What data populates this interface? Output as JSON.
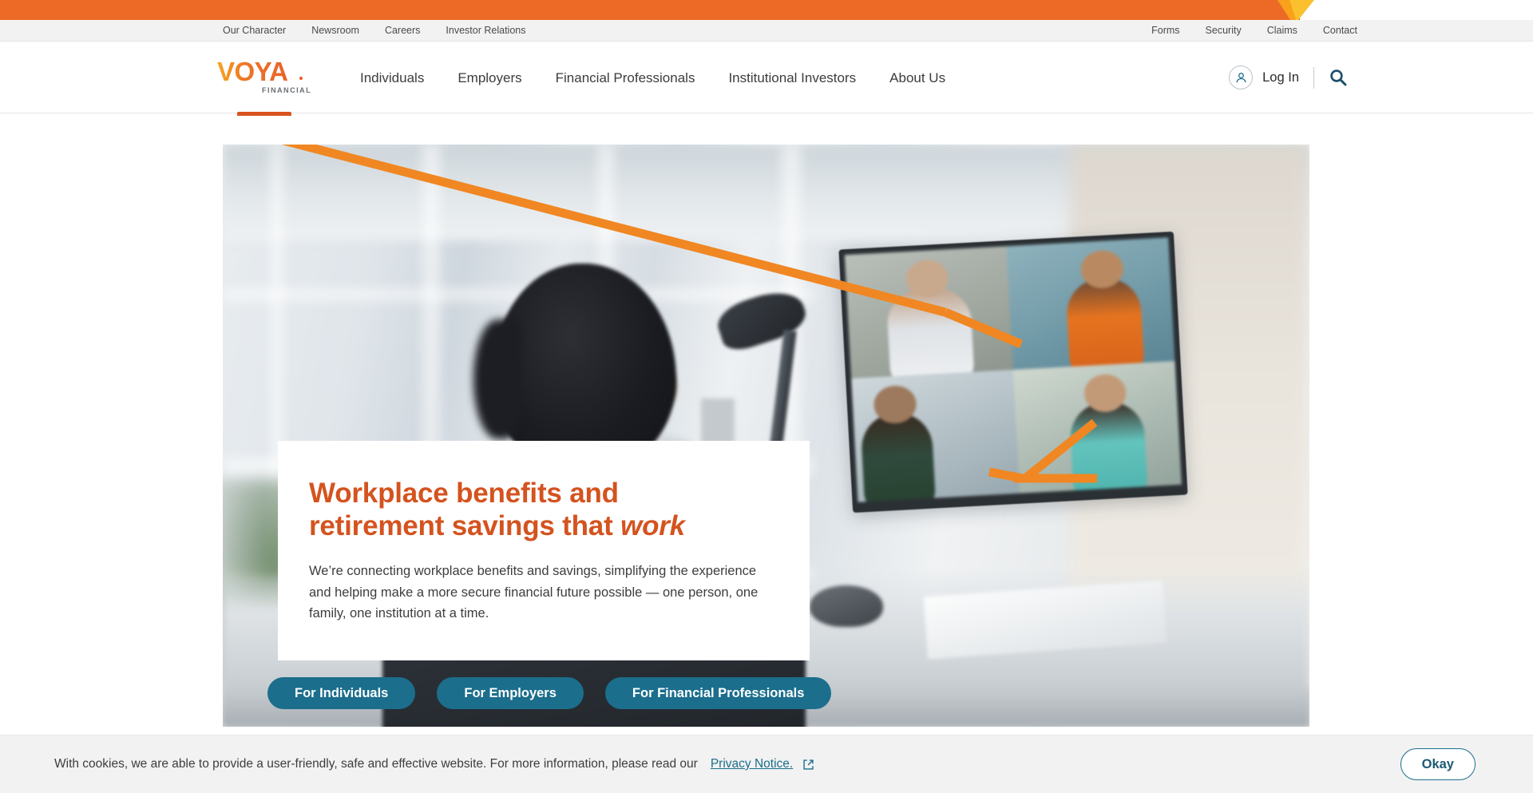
{
  "brand": {
    "logo_text": "VOYA",
    "logo_sub": "FINANCIAL",
    "orange": "#EC6A26",
    "gold": "#F9B233",
    "teal": "#1B6E8C",
    "headline_orange": "#D4531F"
  },
  "utility_nav": {
    "left": [
      {
        "label": "Our Character"
      },
      {
        "label": "Newsroom"
      },
      {
        "label": "Careers"
      },
      {
        "label": "Investor Relations"
      }
    ],
    "right": [
      {
        "label": "Forms"
      },
      {
        "label": "Security"
      },
      {
        "label": "Claims"
      },
      {
        "label": "Contact"
      }
    ]
  },
  "main_nav": {
    "items": [
      {
        "label": "Individuals"
      },
      {
        "label": "Employers"
      },
      {
        "label": "Financial Professionals"
      },
      {
        "label": "Institutional Investors"
      },
      {
        "label": "About Us"
      }
    ],
    "login_label": "Log In",
    "user_icon": "user-icon",
    "search_icon": "search-icon"
  },
  "hero": {
    "title_line1": "Workplace benefits and",
    "title_line2_pre": "retirement savings that ",
    "title_line2_em": "work",
    "subtitle": "We’re connecting workplace benefits and savings, simplifying the experience and helping make a more secure financial future possible — one person, one family, one institution at a time.",
    "ctas": [
      {
        "label": "For Individuals"
      },
      {
        "label": "For Employers"
      },
      {
        "label": "For Financial Professionals"
      }
    ]
  },
  "cookie_banner": {
    "message": "With cookies, we are able to provide a user-friendly, safe and effective website. For more information, please read our",
    "link_label": "Privacy Notice.",
    "external_icon": "external-link-icon",
    "accept_label": "Okay"
  }
}
